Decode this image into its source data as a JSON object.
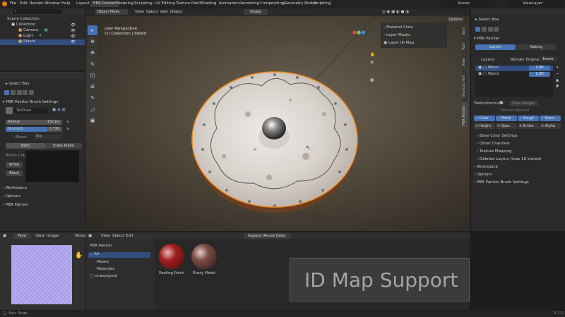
{
  "top_menu": [
    "File",
    "Edit",
    "Render",
    "Window",
    "Help"
  ],
  "workspaces": [
    "Layout",
    "PBR Painter",
    "Modeling",
    "Sculpting",
    "UV Editing",
    "Texture Paint",
    "Shading",
    "Animation",
    "Rendering",
    "Compositing",
    "Geometry Nodes",
    "Scripting"
  ],
  "active_workspace": "PBR Painter",
  "scene": "Scene",
  "view_layer": "ViewLayer",
  "outliner": {
    "root": "Scene Collection",
    "collection": "Collection",
    "items": [
      "Camera",
      "Light",
      "Shield"
    ]
  },
  "left_tool": {
    "select": "Select Box",
    "brush_header": "PBR Painter Brush Settings",
    "brush_name": "TexDraw",
    "radius_label": "Radius",
    "radius_value": "152 px",
    "strength_label": "Strength",
    "strength_value": "0.736",
    "blend_label": "Blend",
    "blend_value": "Mix",
    "paint_btn": "Paint",
    "erase_btn": "Erase Alpha",
    "brush_color": "Brush Color",
    "white": "White",
    "black": "Black",
    "sections": [
      "Workspace",
      "Options",
      "PBR Painter"
    ]
  },
  "viewport": {
    "mode": "Object Mode",
    "menu": [
      "View",
      "Select",
      "Add",
      "Object"
    ],
    "orientation": "Global",
    "options": "Options",
    "persp": "User Perspective",
    "collection_label": "(1) Collection | Shield",
    "overlay_items": [
      "Material Slots",
      "Layer Masks",
      "Layer ID Map"
    ],
    "vtabs": [
      "Item",
      "Tool",
      "View",
      "PBR Painter",
      "Shortcut VUr"
    ]
  },
  "right_panel": {
    "select": "Select Box",
    "title": "PBR Painter",
    "tab_layers": "Layers",
    "tab_baking": "Baking",
    "layers_label": "Layers:",
    "engine_label": "Render Engine:",
    "engine_value": "Eevee",
    "layers": [
      {
        "name": "Metal",
        "value": "1.00"
      },
      {
        "name": "Wood",
        "value": "1.00"
      }
    ],
    "tools_label": "Tools/shortcuts:",
    "save_images": "Save Images",
    "refresh": "Refresh Material",
    "channels_row1": [
      "Color",
      "Metal",
      "Rough",
      "Norm"
    ],
    "channels_row2": [
      "Height",
      "Spec",
      "Emiss",
      "Alpha"
    ],
    "sub": [
      "Base Color Settings",
      "Other Channels",
      "Texture Mapping",
      "Deleted Layers (max 10 stored)"
    ],
    "sections": [
      "Workspace",
      "Options",
      "PBR Painter Brush Settings"
    ]
  },
  "image_editor": {
    "menu": [
      "Paint",
      "View",
      "Image"
    ],
    "image": "Wood"
  },
  "asset_browser": {
    "menu": [
      "View",
      "Select",
      "Edit"
    ],
    "import": "Append (Reuse Data)",
    "library": "PBR Painter",
    "categories": [
      "All",
      "Masks",
      "Materials",
      "Unassigned"
    ],
    "assets": [
      "Peeling Paint",
      "Rusty Metal"
    ]
  },
  "overlay_title": "ID Map Support",
  "status_left": "Axis Snap",
  "version": "3.1.0"
}
